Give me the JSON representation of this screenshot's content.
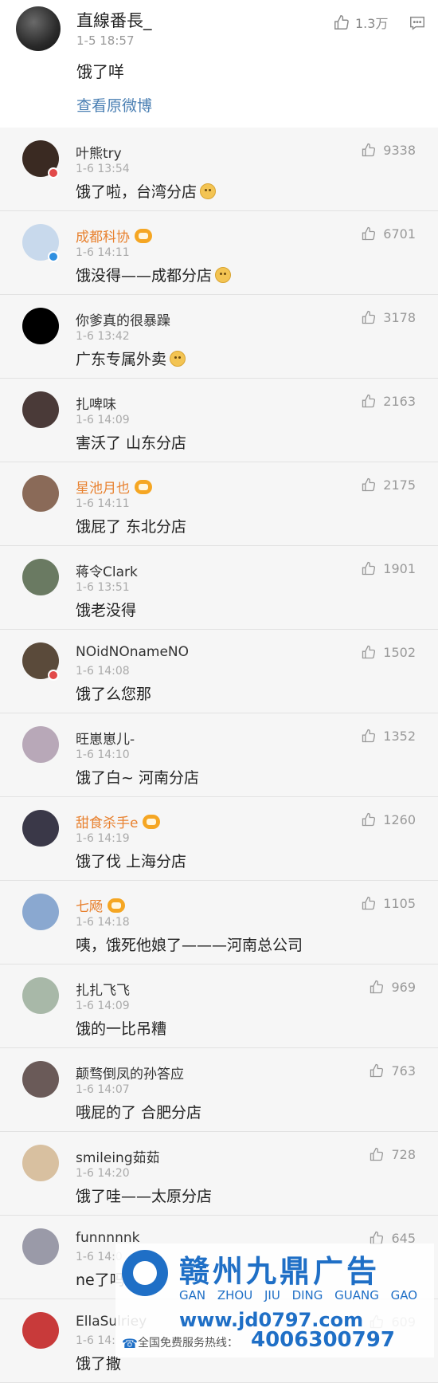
{
  "post": {
    "author": "直線番長_",
    "time": "1-5 18:57",
    "text": "饿了咩",
    "link": "查看原微博",
    "likes": "1.3万",
    "icons": {
      "like": "thumbs-up-icon",
      "comment": "comment-icon"
    }
  },
  "comments": [
    {
      "name": "叶熊try",
      "time": "1-6 13:54",
      "text": "饿了啦，台湾分店",
      "likes": "9338",
      "vip": false,
      "emoji": true,
      "badge": "#e24a4a",
      "avatar_color": "#3a2a22"
    },
    {
      "name": "成都科协",
      "time": "1-6 14:11",
      "text": "饿没得——成都分店",
      "likes": "6701",
      "vip": true,
      "emoji": true,
      "badge": "#2f8fe0",
      "avatar_color": "#c8d9ec"
    },
    {
      "name": "你爹真的很暴躁",
      "time": "1-6 13:42",
      "text": "广东专属外卖",
      "likes": "3178",
      "vip": false,
      "emoji": true,
      "badge": "",
      "avatar_color": "#000000"
    },
    {
      "name": "扎啤味",
      "time": "1-6 14:09",
      "text": "害沃了 山东分店",
      "likes": "2163",
      "vip": false,
      "emoji": false,
      "badge": "",
      "avatar_color": "#4a3a38"
    },
    {
      "name": "星池月也",
      "time": "1-6 14:11",
      "text": "饿屁了 东北分店",
      "likes": "2175",
      "vip": true,
      "emoji": false,
      "badge": "",
      "avatar_color": "#8a6a58"
    },
    {
      "name": "蒋令Clark",
      "time": "1-6 13:51",
      "text": "饿老没得",
      "likes": "1901",
      "vip": false,
      "emoji": false,
      "badge": "",
      "avatar_color": "#6a7a62"
    },
    {
      "name": "NOidNOnameNO",
      "time": "1-6 14:08",
      "text": "饿了么您那",
      "likes": "1502",
      "vip": false,
      "emoji": false,
      "badge": "#e24a4a",
      "avatar_color": "#5a4a3a"
    },
    {
      "name": "旺崽崽儿-",
      "time": "1-6 14:10",
      "text": "饿了白~ 河南分店",
      "likes": "1352",
      "vip": false,
      "emoji": false,
      "badge": "",
      "avatar_color": "#b8a8b8"
    },
    {
      "name": "甜食杀手e",
      "time": "1-6 14:19",
      "text": "饿了伐 上海分店",
      "likes": "1260",
      "vip": true,
      "emoji": false,
      "badge": "",
      "avatar_color": "#3a3848"
    },
    {
      "name": "七飏",
      "time": "1-6 14:18",
      "text": "咦，饿死他娘了———河南总公司",
      "likes": "1105",
      "vip": true,
      "emoji": false,
      "badge": "",
      "avatar_color": "#8aa8d0"
    },
    {
      "name": "扎扎飞飞",
      "time": "1-6 14:09",
      "text": "饿的一比吊糟",
      "likes": "969",
      "vip": false,
      "emoji": false,
      "badge": "",
      "avatar_color": "#a8b8a8"
    },
    {
      "name": "颠骛倒凤的孙答应",
      "time": "1-6 14:07",
      "text": "哦屁的了 合肥分店",
      "likes": "763",
      "vip": false,
      "emoji": false,
      "badge": "",
      "avatar_color": "#6a5a58"
    },
    {
      "name": "smileing茹茹",
      "time": "1-6 14:20",
      "text": "饿了哇——太原分店",
      "likes": "728",
      "vip": false,
      "emoji": false,
      "badge": "",
      "avatar_color": "#d8c0a0"
    },
    {
      "name": "funnnnnk",
      "time": "1-6 14:0",
      "text": "ne了吗",
      "likes": "645",
      "vip": false,
      "emoji": false,
      "badge": "",
      "avatar_color": "#9a9aa8"
    },
    {
      "name": "EllaSulriey",
      "time": "1-6 14:",
      "text": "饿了撒",
      "likes": "609",
      "vip": false,
      "emoji": false,
      "badge": "",
      "avatar_color": "#c83a3a"
    }
  ],
  "ad": {
    "title": "赣州九鼎广告",
    "pinyin": "GAN ZHOU JIU DING GUANG GAO",
    "url": "www.jd0797.com",
    "hotline_label": "全国免费服务热线：",
    "phone": "4006300797",
    "colors": {
      "brand": "#1f6fc6"
    }
  },
  "colors": {
    "vip_name": "#e8812f",
    "link": "#4a7fb3",
    "background": "#f6f6f6"
  }
}
